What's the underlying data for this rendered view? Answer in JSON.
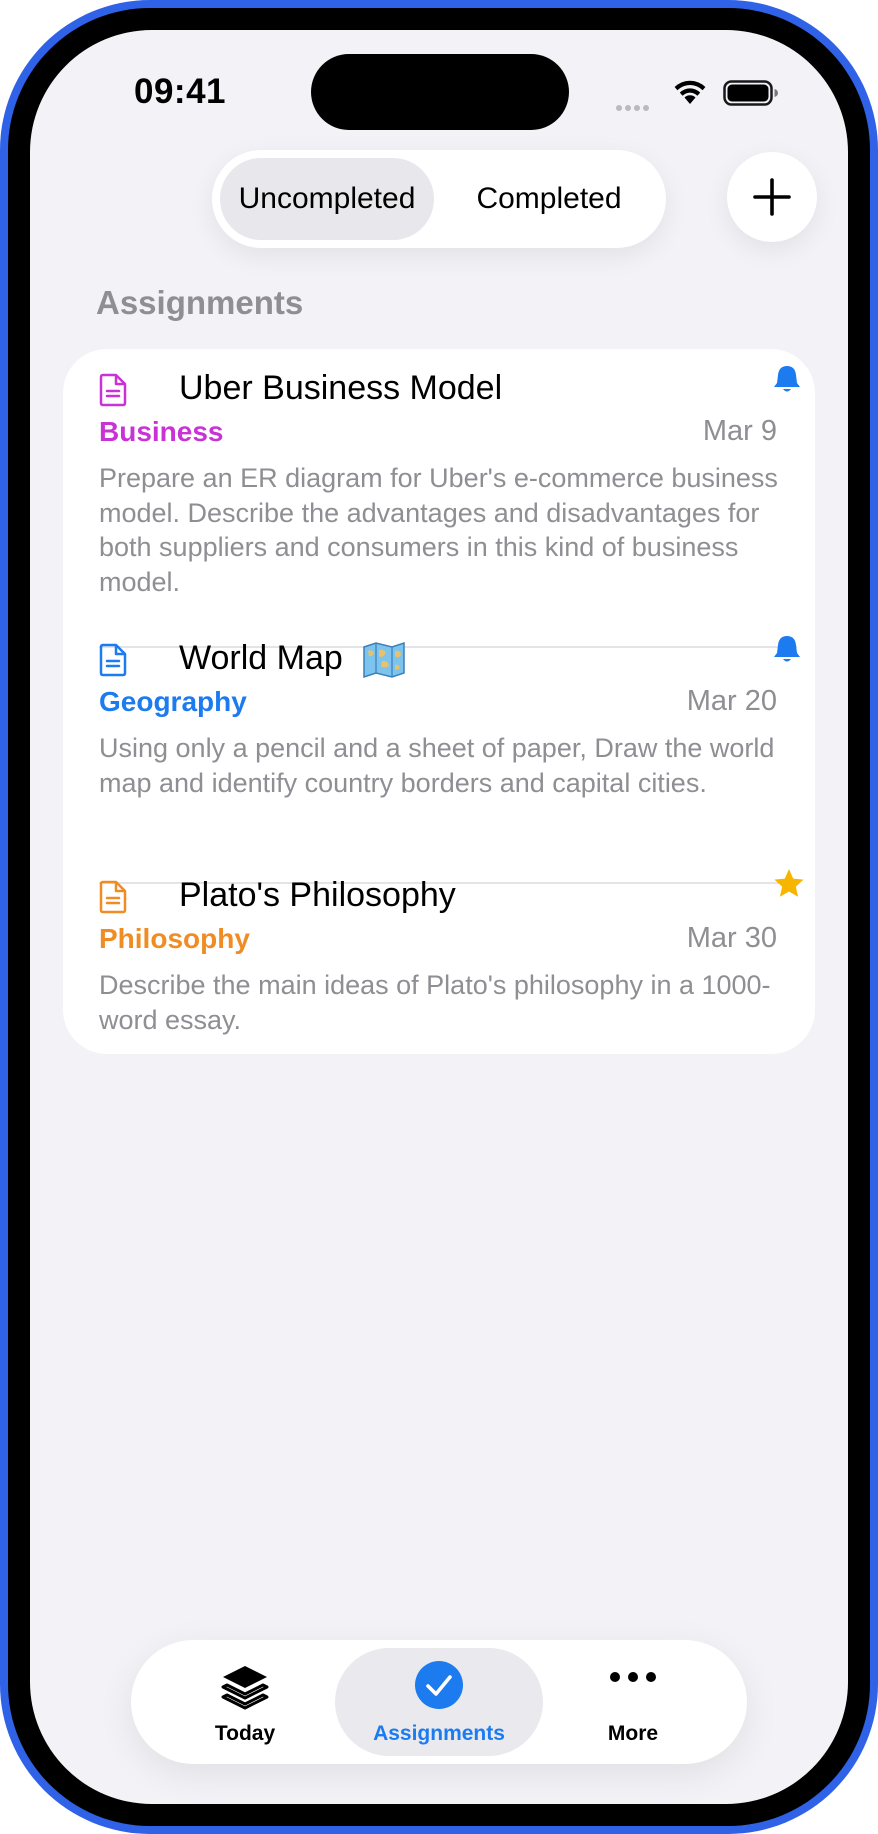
{
  "status_bar": {
    "time": "09:41"
  },
  "segmented": {
    "uncompleted": "Uncompleted",
    "completed": "Completed",
    "selected": "Uncompleted"
  },
  "section": {
    "title": "Assignments"
  },
  "colors": {
    "accent": "#1d7bf0",
    "business": "#c933d6",
    "geography": "#1d7bf0",
    "philosophy": "#f08c24",
    "star": "#f7b500",
    "secondary_text": "#8e8e93"
  },
  "assignments": [
    {
      "title": "Uber Business Model",
      "subject": "Business",
      "date": "Mar 9",
      "description": "Prepare an ER diagram for Uber's e-commerce business model. Describe the advantages and disadvantages for both suppliers and consumers in this kind of business model.",
      "flag_icon": "bell-icon"
    },
    {
      "title": "World Map",
      "title_icon": "world-map-emoji",
      "subject": "Geography",
      "date": "Mar 20",
      "description": "Using only a pencil and a sheet of paper, Draw the world map and identify country borders and capital cities.",
      "flag_icon": "bell-icon"
    },
    {
      "title": "Plato's Philosophy",
      "subject": "Philosophy",
      "date": "Mar 30",
      "description": "Describe the main ideas of Plato's philosophy in a 1000-word essay.",
      "flag_icon": "star-icon"
    }
  ],
  "tabbar": {
    "selected": "Assignments",
    "tabs": [
      {
        "label": "Today",
        "icon": "stack-icon"
      },
      {
        "label": "Assignments",
        "icon": "checkmark-circle-icon"
      },
      {
        "label": "More",
        "icon": "ellipsis-icon"
      }
    ]
  }
}
